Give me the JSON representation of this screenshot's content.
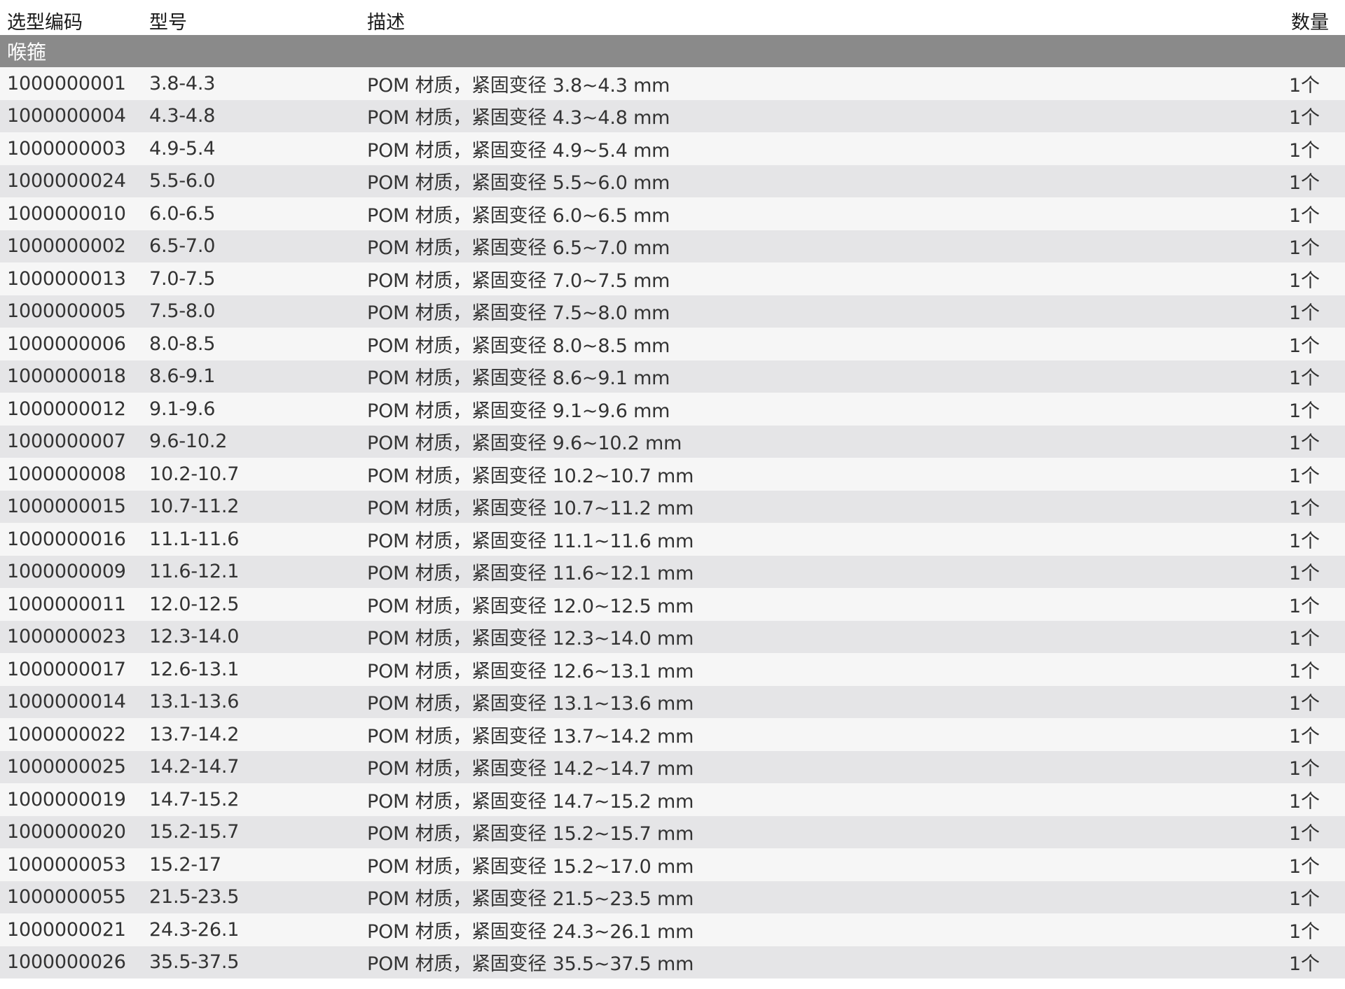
{
  "table": {
    "headers": {
      "code": "选型编码",
      "model": "型号",
      "description": "描述",
      "quantity": "数量"
    },
    "group": "喉箍",
    "rows": [
      {
        "code": "1000000001",
        "model": "3.8-4.3",
        "description": "POM 材质，紧固变径 3.8~4.3 mm",
        "quantity": "1个"
      },
      {
        "code": "1000000004",
        "model": "4.3-4.8",
        "description": "POM 材质，紧固变径 4.3~4.8 mm",
        "quantity": "1个"
      },
      {
        "code": "1000000003",
        "model": "4.9-5.4",
        "description": "POM 材质，紧固变径 4.9~5.4 mm",
        "quantity": "1个"
      },
      {
        "code": "1000000024",
        "model": "5.5-6.0",
        "description": "POM 材质，紧固变径 5.5~6.0 mm",
        "quantity": "1个"
      },
      {
        "code": "1000000010",
        "model": "6.0-6.5",
        "description": "POM 材质，紧固变径 6.0~6.5 mm",
        "quantity": "1个"
      },
      {
        "code": "1000000002",
        "model": "6.5-7.0",
        "description": "POM 材质，紧固变径 6.5~7.0 mm",
        "quantity": "1个"
      },
      {
        "code": "1000000013",
        "model": "7.0-7.5",
        "description": "POM 材质，紧固变径 7.0~7.5 mm",
        "quantity": "1个"
      },
      {
        "code": "1000000005",
        "model": "7.5-8.0",
        "description": "POM 材质，紧固变径 7.5~8.0 mm",
        "quantity": "1个"
      },
      {
        "code": "1000000006",
        "model": "8.0-8.5",
        "description": "POM 材质，紧固变径 8.0~8.5 mm",
        "quantity": "1个"
      },
      {
        "code": "1000000018",
        "model": "8.6-9.1",
        "description": "POM 材质，紧固变径 8.6~9.1 mm",
        "quantity": "1个"
      },
      {
        "code": "1000000012",
        "model": "9.1-9.6",
        "description": "POM 材质，紧固变径 9.1~9.6 mm",
        "quantity": "1个"
      },
      {
        "code": "1000000007",
        "model": "9.6-10.2",
        "description": "POM 材质，紧固变径 9.6~10.2 mm",
        "quantity": "1个"
      },
      {
        "code": "1000000008",
        "model": "10.2-10.7",
        "description": "POM 材质，紧固变径 10.2~10.7 mm",
        "quantity": "1个"
      },
      {
        "code": "1000000015",
        "model": "10.7-11.2",
        "description": "POM 材质，紧固变径 10.7~11.2 mm",
        "quantity": "1个"
      },
      {
        "code": "1000000016",
        "model": "11.1-11.6",
        "description": "POM 材质，紧固变径 11.1~11.6 mm",
        "quantity": "1个"
      },
      {
        "code": "1000000009",
        "model": "11.6-12.1",
        "description": "POM 材质，紧固变径 11.6~12.1 mm",
        "quantity": "1个"
      },
      {
        "code": "1000000011",
        "model": "12.0-12.5",
        "description": "POM 材质，紧固变径 12.0~12.5 mm",
        "quantity": "1个"
      },
      {
        "code": "1000000023",
        "model": "12.3-14.0",
        "description": "POM 材质，紧固变径 12.3~14.0 mm",
        "quantity": "1个"
      },
      {
        "code": "1000000017",
        "model": "12.6-13.1",
        "description": "POM 材质，紧固变径 12.6~13.1 mm",
        "quantity": "1个"
      },
      {
        "code": "1000000014",
        "model": "13.1-13.6",
        "description": "POM 材质，紧固变径 13.1~13.6 mm",
        "quantity": "1个"
      },
      {
        "code": "1000000022",
        "model": "13.7-14.2",
        "description": "POM 材质，紧固变径 13.7~14.2 mm",
        "quantity": "1个"
      },
      {
        "code": "1000000025",
        "model": "14.2-14.7",
        "description": "POM 材质，紧固变径 14.2~14.7 mm",
        "quantity": "1个"
      },
      {
        "code": "1000000019",
        "model": "14.7-15.2",
        "description": "POM 材质，紧固变径 14.7~15.2 mm",
        "quantity": "1个"
      },
      {
        "code": "1000000020",
        "model": "15.2-15.7",
        "description": "POM 材质，紧固变径 15.2~15.7 mm",
        "quantity": "1个"
      },
      {
        "code": "1000000053",
        "model": "15.2-17",
        "description": "POM 材质，紧固变径 15.2~17.0 mm",
        "quantity": "1个"
      },
      {
        "code": "1000000055",
        "model": "21.5-23.5",
        "description": "POM 材质，紧固变径 21.5~23.5 mm",
        "quantity": "1个"
      },
      {
        "code": "1000000021",
        "model": "24.3-26.1",
        "description": "POM 材质，紧固变径 24.3~26.1 mm",
        "quantity": "1个"
      },
      {
        "code": "1000000026",
        "model": "35.5-37.5",
        "description": "POM 材质，紧固变径 35.5~37.5 mm",
        "quantity": "1个"
      }
    ]
  },
  "colors": {
    "group_header_bg": "#8a8a8a",
    "row_light": "#f6f6f6",
    "row_dark": "#e5e5e7",
    "text": "#333333"
  }
}
